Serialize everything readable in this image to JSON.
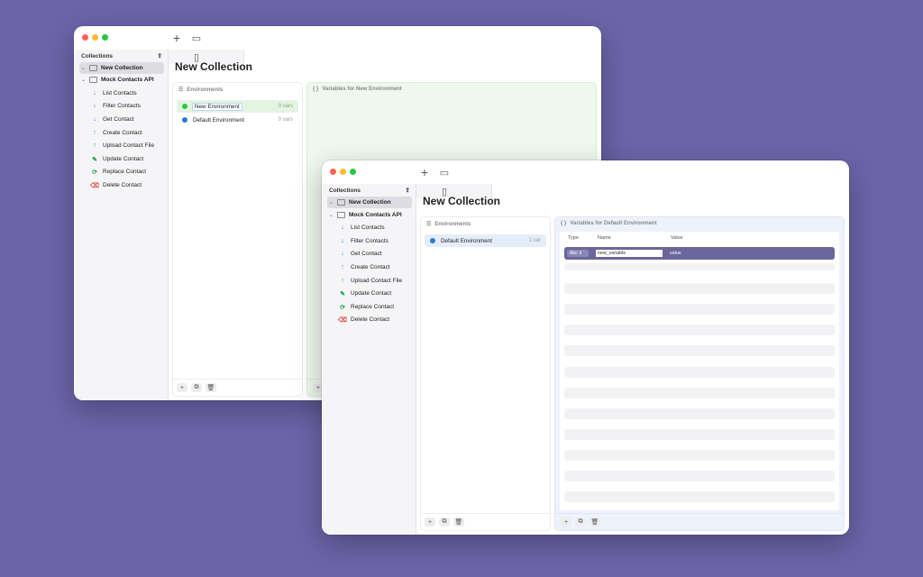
{
  "back_window": {
    "main_title": "New Collection",
    "env_header": "Environments",
    "vars_header": "Variables for New Environment",
    "environments": [
      {
        "name": "New Environment",
        "count": "0 vars",
        "color": "#28c840",
        "selected": true
      },
      {
        "name": "Default Environment",
        "count": "0 vars",
        "color": "#2a7ad6",
        "selected": false
      }
    ]
  },
  "front_window": {
    "main_title": "New Collection",
    "env_header": "Environments",
    "vars_header": "Variables for Default Environment",
    "environments": [
      {
        "name": "Default Environment",
        "count": "1 var",
        "color": "#2a7ad6",
        "selected": true
      }
    ],
    "table": {
      "columns": [
        "Type",
        "Name",
        "Value"
      ],
      "row": {
        "type": "Abc",
        "name": "new_variable",
        "value": "value"
      }
    }
  },
  "sidebar": {
    "header": "Collections",
    "collections": [
      {
        "label": "New Collection",
        "selected": true
      },
      {
        "label": "Mock Contacts API",
        "selected": false
      }
    ],
    "endpoints": [
      {
        "label": "List Contacts",
        "icon": "arrow-down-icon",
        "glyph": "↓"
      },
      {
        "label": "Filter Contacts",
        "icon": "arrow-down-icon",
        "glyph": "↓"
      },
      {
        "label": "Get Contact",
        "icon": "arrow-down-icon",
        "glyph": "↓"
      },
      {
        "label": "Create Contact",
        "icon": "arrow-up-icon",
        "glyph": "↑"
      },
      {
        "label": "Upload Contact File",
        "icon": "arrow-up-icon",
        "glyph": "↑"
      },
      {
        "label": "Update Contact",
        "icon": "pencil-icon",
        "glyph": "✎"
      },
      {
        "label": "Replace Contact",
        "icon": "refresh-icon",
        "glyph": "⟳"
      },
      {
        "label": "Delete Contact",
        "icon": "eraser-icon",
        "glyph": "⌫"
      }
    ]
  },
  "icons": {
    "sidebar_toggle": "▯",
    "new": "+",
    "chat": "▭",
    "export": "⇪",
    "add": "+",
    "duplicate": "⧉",
    "trash": "🗑",
    "env_list": "☰",
    "braces": "{ }"
  },
  "colors": {
    "background": "#6b64a8",
    "accent_row": "#6b669c"
  }
}
